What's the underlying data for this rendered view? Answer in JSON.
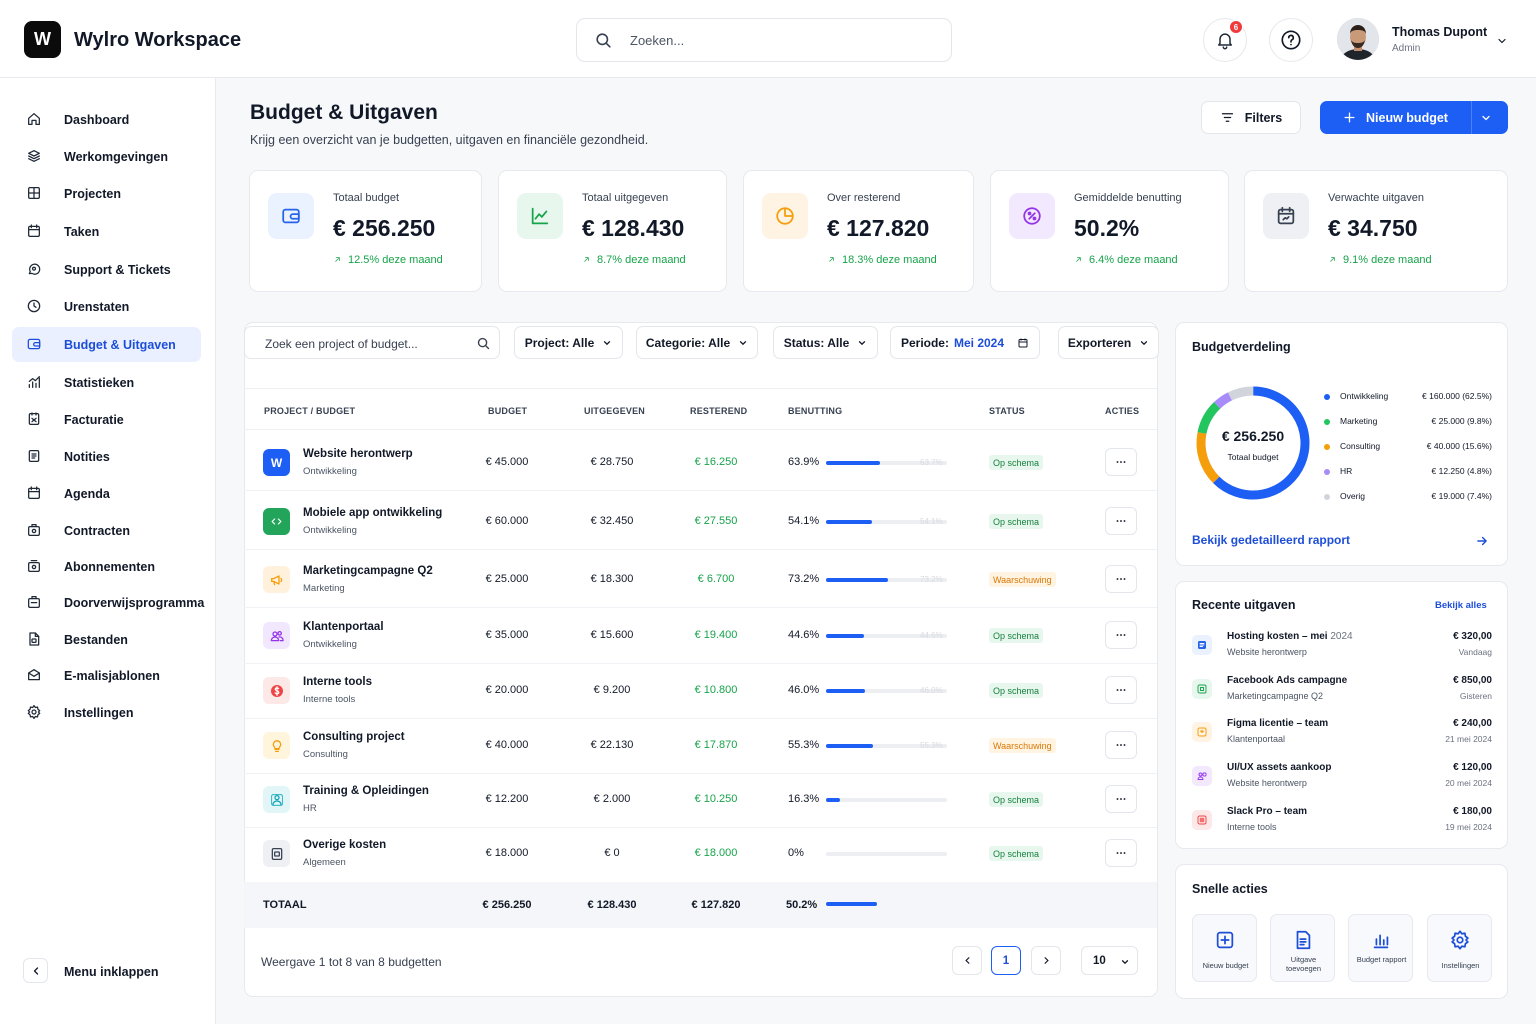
{
  "app": {
    "logo_letter": "W",
    "title": "Wylro Workspace"
  },
  "header": {
    "search_placeholder": "Zoeken...",
    "notifications_count": "6",
    "user": {
      "name": "Thomas Dupont",
      "role": "Admin"
    }
  },
  "sidebar": {
    "items": [
      {
        "label": "Dashboard",
        "icon": "home-icon"
      },
      {
        "label": "Werkomgevingen",
        "icon": "layers-icon"
      },
      {
        "label": "Projecten",
        "icon": "grid-icon"
      },
      {
        "label": "Taken",
        "icon": "calendar-icon"
      },
      {
        "label": "Support & Tickets",
        "icon": "chat-icon"
      },
      {
        "label": "Urenstaten",
        "icon": "clock-icon"
      },
      {
        "label": "Budget & Uitgaven",
        "icon": "wallet-icon"
      },
      {
        "label": "Statistieken",
        "icon": "chart-icon"
      },
      {
        "label": "Facturatie",
        "icon": "invoice-icon"
      },
      {
        "label": "Notities",
        "icon": "note-icon"
      },
      {
        "label": "Agenda",
        "icon": "calendar-icon"
      },
      {
        "label": "Contracten",
        "icon": "contract-icon"
      },
      {
        "label": "Abonnementen",
        "icon": "subscription-icon"
      },
      {
        "label": "Doorverwijsprogramma",
        "icon": "referral-icon"
      },
      {
        "label": "Bestanden",
        "icon": "file-icon"
      },
      {
        "label": "E-malisjablonen",
        "icon": "mail-icon"
      },
      {
        "label": "Instellingen",
        "icon": "gear-icon"
      }
    ],
    "active_index": 6,
    "collapse_label": "Menu inklappen"
  },
  "page": {
    "title": "Budget & Uitgaven",
    "subtitle": "Krijg een overzicht van je budgetten, uitgaven en financiële gezondheid.",
    "filters_label": "Filters",
    "new_budget_label": "Nieuw budget"
  },
  "stats": [
    {
      "label": "Totaal budget",
      "value": "€ 256.250",
      "change": "12.5% deze maand",
      "color": "#2563eb"
    },
    {
      "label": "Totaal uitgegeven",
      "value": "€ 128.430",
      "change": "8.7% deze maand",
      "color": "#16a34a"
    },
    {
      "label": "Over resterend",
      "value": "€ 127.820",
      "change": "18.3% deze maand",
      "color": "#f59e0b"
    },
    {
      "label": "Gemiddelde benutting",
      "value": "50.2%",
      "change": "6.4% deze maand",
      "color": "#9333ea"
    },
    {
      "label": "Verwachte uitgaven",
      "value": "€ 34.750",
      "change": "9.1% deze maand",
      "color": "#374151"
    }
  ],
  "toolbar": {
    "search_placeholder": "Zoek een project of budget...",
    "project_label": "Project: Alle",
    "category_label": "Categorie: Alle",
    "status_label": "Status: Alle",
    "period_prefix": "Periode:",
    "period_value": "Mei 2024",
    "export_label": "Exporteren"
  },
  "table": {
    "headers": {
      "project": "PROJECT / BUDGET",
      "budget": "BUDGET",
      "spent": "UITGEGEVEN",
      "remaining": "RESTEREND",
      "usage": "BENUTTING",
      "status": "STATUS",
      "actions": "ACTIES"
    },
    "rows": [
      {
        "name": "Website herontwerp",
        "category": "Ontwikkeling",
        "budget": "€ 45.000",
        "spent": "€ 28.750",
        "remaining": "€ 16.250",
        "usage": "63.9%",
        "usage_value": 63.9,
        "ghost": "63.7%",
        "status": "Op schema",
        "status_type": "ok",
        "icon": "w-logo-icon",
        "color": "#1d5ef4"
      },
      {
        "name": "Mobiele app ontwikkeling",
        "category": "Ontwikkeling",
        "budget": "€ 60.000",
        "spent": "€ 32.450",
        "remaining": "€ 27.550",
        "usage": "54.1%",
        "usage_value": 54.1,
        "ghost": "54.1%",
        "status": "Op schema",
        "status_type": "ok",
        "icon": "code-icon",
        "color": "#22a55a"
      },
      {
        "name": "Marketingcampagne Q2",
        "category": "Marketing",
        "budget": "€ 25.000",
        "spent": "€ 18.300",
        "remaining": "€ 6.700",
        "usage": "73.2%",
        "usage_value": 73.2,
        "ghost": "73.2%",
        "status": "Waarschuwing",
        "status_type": "warn",
        "icon": "megaphone-icon",
        "color": "#f59e0b"
      },
      {
        "name": "Klantenportaal",
        "category": "Ontwikkeling",
        "budget": "€ 35.000",
        "spent": "€ 15.600",
        "remaining": "€ 19.400",
        "usage": "44.6%",
        "usage_value": 44.6,
        "ghost": "44.6%",
        "status": "Op schema",
        "status_type": "ok",
        "icon": "users-icon",
        "color": "#9333ea"
      },
      {
        "name": "Interne tools",
        "category": "Interne tools",
        "budget": "€ 20.000",
        "spent": "€ 9.200",
        "remaining": "€ 10.800",
        "usage": "46.0%",
        "usage_value": 46.0,
        "ghost": "46.0%",
        "status": "Op schema",
        "status_type": "ok",
        "icon": "dollar-icon",
        "color": "#ef4444"
      },
      {
        "name": "Consulting project",
        "category": "Consulting",
        "budget": "€ 40.000",
        "spent": "€ 22.130",
        "remaining": "€ 17.870",
        "usage": "55.3%",
        "usage_value": 55.3,
        "ghost": "55.3%",
        "status": "Waarschuwing",
        "status_type": "warn",
        "icon": "lightbulb-icon",
        "color": "#f59e0b"
      },
      {
        "name": "Training & Opleidingen",
        "category": "HR",
        "budget": "€ 12.200",
        "spent": "€ 2.000",
        "remaining": "€ 10.250",
        "usage": "16.3%",
        "usage_value": 16.3,
        "ghost": "",
        "status": "Op schema",
        "status_type": "ok",
        "icon": "person-icon",
        "color": "#0ea5b7"
      },
      {
        "name": "Overige kosten",
        "category": "Algemeen",
        "budget": "€ 18.000",
        "spent": "€ 0",
        "remaining": "€ 18.000",
        "usage": "0%",
        "usage_value": 0,
        "ghost": "",
        "status": "Op schema",
        "status_type": "ok",
        "icon": "box-icon",
        "color": "#374151"
      }
    ],
    "total": {
      "label": "TOTAAL",
      "budget": "€ 256.250",
      "spent": "€ 128.430",
      "remaining": "€ 127.820",
      "usage": "50.2%",
      "usage_value": 50.2
    },
    "pagination": {
      "text": "Weergave 1 tot 8 van 8 budgetten",
      "current_page": "1",
      "page_size": "10"
    }
  },
  "distribution": {
    "title": "Budgetverdeling",
    "center_value": "€ 256.250",
    "center_label": "Totaal budget",
    "items": [
      {
        "name": "Ontwikkeling",
        "value": "€ 160.000 (62.5%)",
        "share": 62.5,
        "color": "#1d5ef4"
      },
      {
        "name": "Marketing",
        "value": "€ 25.000 (9.8%)",
        "share": 9.8,
        "color": "#22c55e"
      },
      {
        "name": "Consulting",
        "value": "€ 40.000 (15.6%)",
        "share": 15.6,
        "color": "#f59e0b"
      },
      {
        "name": "HR",
        "value": "€ 12.250 (4.8%)",
        "share": 4.8,
        "color": "#a78bfa"
      },
      {
        "name": "Overig",
        "value": "€ 19.000 (7.4%)",
        "share": 7.4,
        "color": "#d1d5db"
      }
    ],
    "link": "Bekijk gedetailleerd rapport"
  },
  "recent": {
    "title": "Recente uitgaven",
    "view_all": "Bekijk alles",
    "items": [
      {
        "name": "Hosting kosten – mei",
        "name_suffix": "2024",
        "project": "Website herontwerp",
        "amount": "€ 320,00",
        "date": "Vandaag",
        "color": "#2563eb",
        "icon": "server-icon"
      },
      {
        "name": "Facebook Ads campagne",
        "name_suffix": "",
        "project": "Marketingcampagne Q2",
        "amount": "€ 850,00",
        "date": "Gisteren",
        "color": "#16a34a",
        "icon": "ads-icon"
      },
      {
        "name": "Figma licentie – team",
        "name_suffix": "",
        "project": "Klantenportaal",
        "amount": "€ 240,00",
        "date": "21 mei 2024",
        "color": "#f59e0b",
        "icon": "figma-icon"
      },
      {
        "name": "UI/UX assets aankoop",
        "name_suffix": "",
        "project": "Website herontwerp",
        "amount": "€ 120,00",
        "date": "20 mei 2024",
        "color": "#9333ea",
        "icon": "assets-icon"
      },
      {
        "name": "Slack Pro – team",
        "name_suffix": "",
        "project": "Interne tools",
        "amount": "€ 180,00",
        "date": "19 mei 2024",
        "color": "#ef4444",
        "icon": "slack-icon"
      }
    ]
  },
  "quick": {
    "title": "Snelle acties",
    "items": [
      {
        "label": "Nieuw budget"
      },
      {
        "label": "Uitgave toevoegen"
      },
      {
        "label": "Budget rapport"
      },
      {
        "label": "Instellingen"
      }
    ]
  }
}
